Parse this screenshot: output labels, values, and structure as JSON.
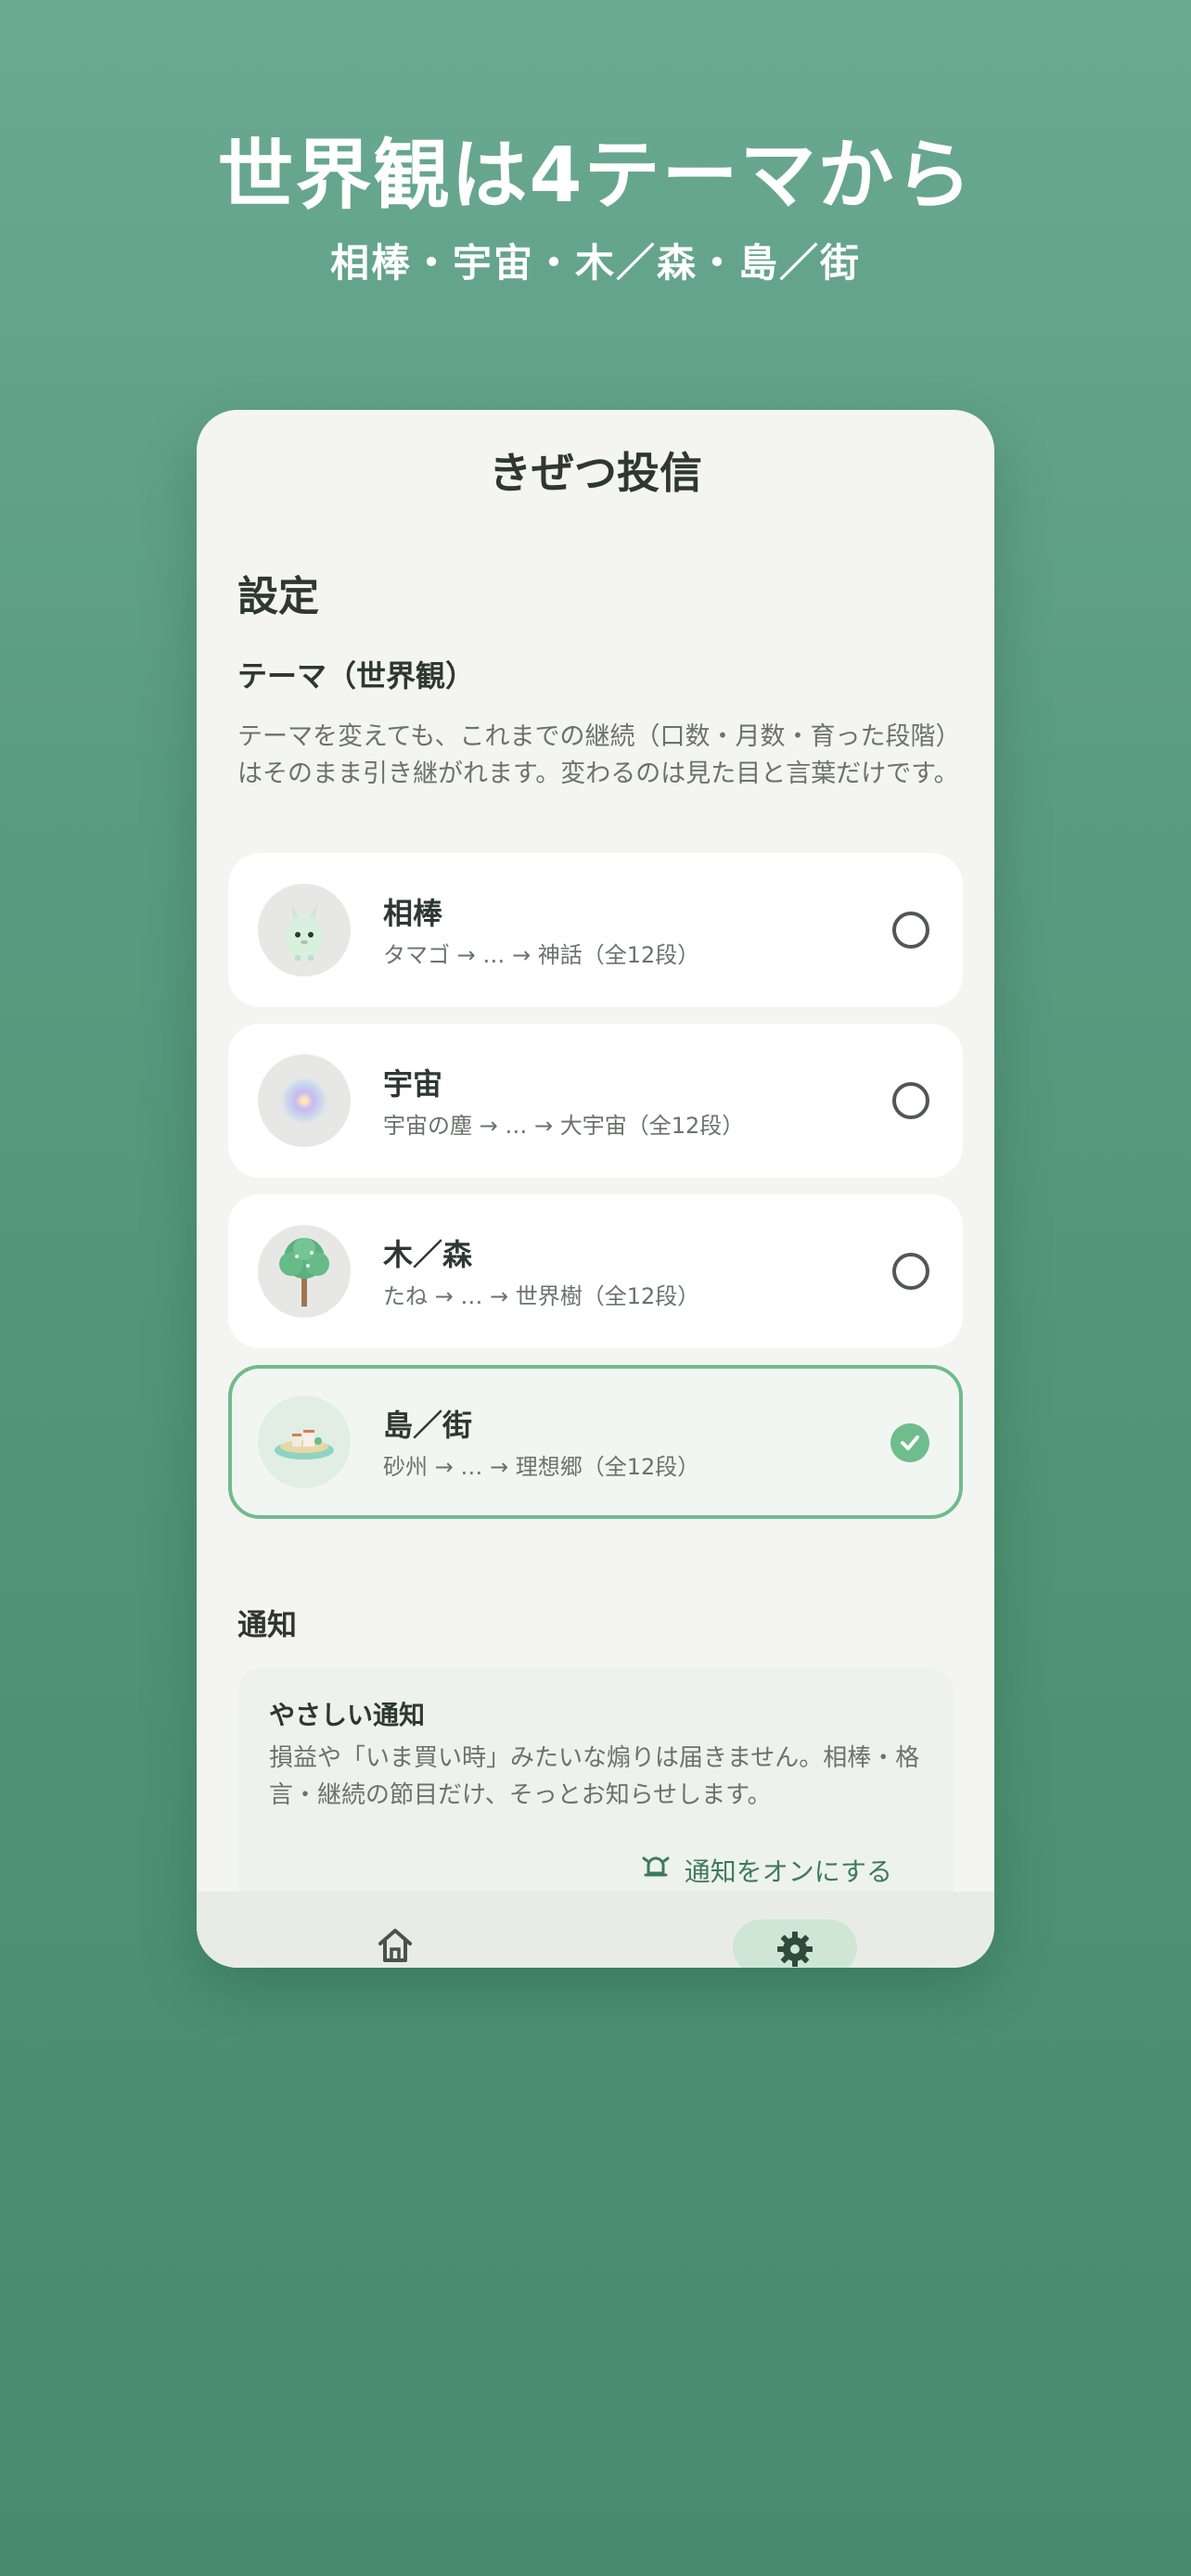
{
  "hero": {
    "title": "世界観は4テーマから",
    "subtitle": "相棒・宇宙・木／森・島／街"
  },
  "app": {
    "title": "きぜつ投信"
  },
  "settings": {
    "title": "設定",
    "theme_heading": "テーマ（世界観）",
    "theme_description": "テーマを変えても、これまでの継続（口数・月数・育った段階）はそのまま引き継がれます。変わるのは見た目と言葉だけです。",
    "themes": [
      {
        "name": "相棒",
        "stages": "タマゴ → … → 神話（全12段）",
        "icon": "companion-creature-icon",
        "selected": false
      },
      {
        "name": "宇宙",
        "stages": "宇宙の塵 → … → 大宇宙（全12段）",
        "icon": "galaxy-icon",
        "selected": false
      },
      {
        "name": "木／森",
        "stages": "たね → … → 世界樹（全12段）",
        "icon": "tree-icon",
        "selected": false
      },
      {
        "name": "島／街",
        "stages": "砂州 → … → 理想郷（全12段）",
        "icon": "island-town-icon",
        "selected": true
      }
    ],
    "notification_heading": "通知",
    "notification": {
      "title": "やさしい通知",
      "body": "損益や「いま買い時」みたいな煽りは届きません。相棒・格言・継続の節目だけ、そっとお知らせします。",
      "button": "通知をオンにする",
      "button_icon": "alarm-bell-icon"
    }
  },
  "nav": {
    "items": [
      {
        "icon": "home-icon",
        "active": false
      },
      {
        "icon": "gear-icon",
        "active": true
      }
    ]
  },
  "colors": {
    "accent": "#6fbc8c",
    "background_top": "#6aa992",
    "background_bottom": "#468b6c"
  }
}
